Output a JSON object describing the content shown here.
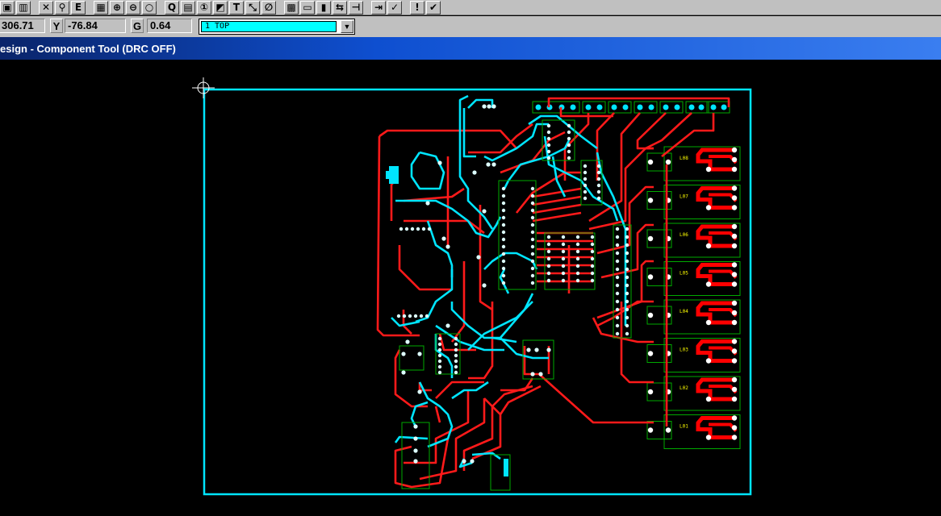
{
  "toolbar": {
    "buttons": [
      {
        "name": "save-icon",
        "glyph": "▣"
      },
      {
        "name": "bar-chart-icon",
        "glyph": "▥"
      },
      {
        "name": "delete-icon",
        "glyph": "✕"
      },
      {
        "name": "find-icon",
        "glyph": "⚲"
      },
      {
        "name": "edit-icon",
        "glyph": "E"
      },
      {
        "name": "grid-icon",
        "glyph": "▦"
      },
      {
        "name": "zoom-in-icon",
        "glyph": "⊕"
      },
      {
        "name": "zoom-out-icon",
        "glyph": "⊖"
      },
      {
        "name": "zoom-fit-icon",
        "glyph": "○"
      },
      {
        "name": "query-icon",
        "glyph": "Q"
      },
      {
        "name": "component-icon",
        "glyph": "▤"
      },
      {
        "name": "pin-number-icon",
        "glyph": "①"
      },
      {
        "name": "draw-icon",
        "glyph": "◩"
      },
      {
        "name": "text-icon",
        "glyph": "T"
      },
      {
        "name": "route-icon",
        "glyph": "⤡"
      },
      {
        "name": "no-connect-icon",
        "glyph": "∅"
      },
      {
        "name": "color-palette-icon",
        "glyph": "▩"
      },
      {
        "name": "drc-report-icon",
        "glyph": "▭"
      },
      {
        "name": "layer-pair-icon",
        "glyph": "▮"
      },
      {
        "name": "swap-icon",
        "glyph": "⇆"
      },
      {
        "name": "align-icon",
        "glyph": "⊣"
      },
      {
        "name": "import-icon",
        "glyph": "⇥"
      },
      {
        "name": "checkmark-route-icon",
        "glyph": "✓"
      },
      {
        "name": "warning-icon",
        "glyph": "!"
      },
      {
        "name": "drc-check-icon",
        "glyph": "✔"
      }
    ]
  },
  "coords": {
    "x_value": "306.71",
    "y_label": "Y",
    "y_value": "-76.84",
    "g_label": "G",
    "g_value": "0.64"
  },
  "layer": {
    "selected": "1 TOP"
  },
  "window": {
    "title": "esign - Component Tool (DRC OFF)"
  },
  "board": {
    "led_labels": [
      "L08",
      "L07",
      "L06",
      "L05",
      "L04",
      "L03",
      "L02",
      "L01"
    ]
  },
  "colors": {
    "board_outline": "#00e5ff",
    "trace_top": "#ff0000",
    "trace_bottom": "#00e5ff",
    "silkscreen": "#00cc00",
    "background": "#000000",
    "titlebar": "#0e4fd0"
  }
}
